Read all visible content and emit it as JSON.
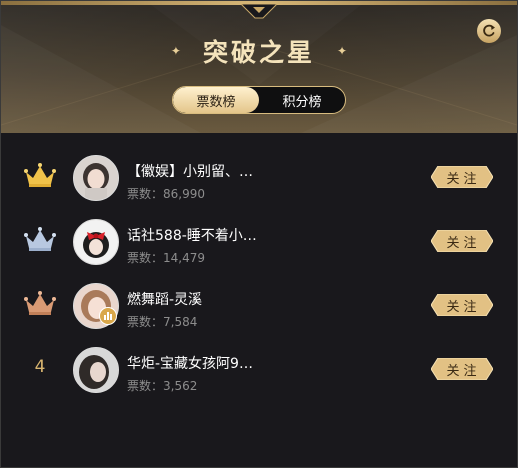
{
  "header": {
    "title": "突破之星",
    "sparkle_left": "✦",
    "sparkle_right": "✦"
  },
  "tabs": [
    {
      "label": "票数榜",
      "active": true
    },
    {
      "label": "积分榜",
      "active": false
    }
  ],
  "list": [
    {
      "rank": "",
      "rank_icon": "gold-crown-icon",
      "name": "【徽娱】小别留、…",
      "votes": "票数：86,990",
      "follow_label": "关注"
    },
    {
      "rank": "",
      "rank_icon": "silver-crown-icon",
      "name": "话社588-睡不着小…",
      "votes": "票数：14,479",
      "follow_label": "关注"
    },
    {
      "rank": "",
      "rank_icon": "bronze-crown-icon",
      "name": "燃舞蹈-灵溪",
      "votes": "票数：7,584",
      "follow_label": "关注"
    },
    {
      "rank": "4",
      "rank_icon": "",
      "name": "华炬-宝藏女孩阿9…",
      "votes": "票数：3,562",
      "follow_label": "关注"
    }
  ],
  "colors": {
    "gold": "#f0c24a",
    "silver": "#b8c8e0",
    "bronze": "#d99a74",
    "accent": "#e3c58a"
  }
}
